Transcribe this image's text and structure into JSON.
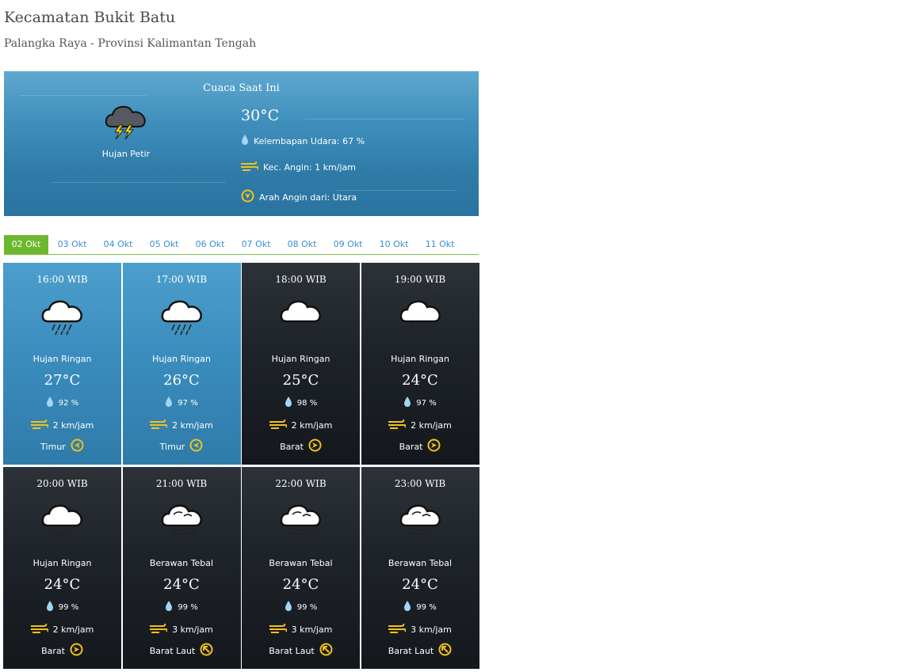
{
  "location": {
    "title": "Kecamatan Bukit Batu",
    "subtitle": "Palangka Raya - Provinsi Kalimantan Tengah"
  },
  "current": {
    "heading": "Cuaca Saat Ini",
    "condition": "Hujan Petir",
    "icon": "thunderstorm-cloud-icon",
    "temperature": "30°C",
    "humidity": "Kelembapan Udara: 67 %",
    "wind_speed": "Kec. Angin: 1 km/jam",
    "wind_direction": "Arah Angin dari: Utara"
  },
  "tabs": [
    "02 Okt",
    "03 Okt",
    "04 Okt",
    "05 Okt",
    "06 Okt",
    "07 Okt",
    "08 Okt",
    "09 Okt",
    "10 Okt",
    "11 Okt"
  ],
  "active_tab": "02 Okt",
  "forecast": [
    {
      "time": "16:00 WIB",
      "condition": "Hujan Ringan",
      "icon": "light-rain-icon",
      "temp": "27°C",
      "humidity": "92 %",
      "wind": "2 km/jam",
      "direction": "Timur",
      "theme": "day"
    },
    {
      "time": "17:00 WIB",
      "condition": "Hujan Ringan",
      "icon": "light-rain-icon",
      "temp": "26°C",
      "humidity": "97 %",
      "wind": "2 km/jam",
      "direction": "Timur",
      "theme": "day"
    },
    {
      "time": "18:00 WIB",
      "condition": "Hujan Ringan",
      "icon": "light-rain-icon",
      "temp": "25°C",
      "humidity": "98 %",
      "wind": "2 km/jam",
      "direction": "Barat",
      "theme": "night"
    },
    {
      "time": "19:00 WIB",
      "condition": "Hujan Ringan",
      "icon": "light-rain-icon",
      "temp": "24°C",
      "humidity": "97 %",
      "wind": "2 km/jam",
      "direction": "Barat",
      "theme": "night"
    },
    {
      "time": "20:00 WIB",
      "condition": "Hujan Ringan",
      "icon": "light-rain-icon",
      "temp": "24°C",
      "humidity": "99 %",
      "wind": "2 km/jam",
      "direction": "Barat",
      "theme": "night"
    },
    {
      "time": "21:00 WIB",
      "condition": "Berawan Tebal",
      "icon": "overcast-cloud-icon",
      "temp": "24°C",
      "humidity": "99 %",
      "wind": "3 km/jam",
      "direction": "Barat Laut",
      "theme": "night"
    },
    {
      "time": "22:00 WIB",
      "condition": "Berawan Tebal",
      "icon": "overcast-cloud-icon",
      "temp": "24°C",
      "humidity": "99 %",
      "wind": "3 km/jam",
      "direction": "Barat Laut",
      "theme": "night"
    },
    {
      "time": "23:00 WIB",
      "condition": "Berawan Tebal",
      "icon": "overcast-cloud-icon",
      "temp": "24°C",
      "humidity": "99 %",
      "wind": "3 km/jam",
      "direction": "Barat Laut",
      "theme": "night"
    }
  ],
  "colors": {
    "tab_active": "#6bb82e",
    "tab_link": "#3b8dd0",
    "wind_icon": "#f2c21a",
    "humidity_icon": "#8fd0f5"
  }
}
